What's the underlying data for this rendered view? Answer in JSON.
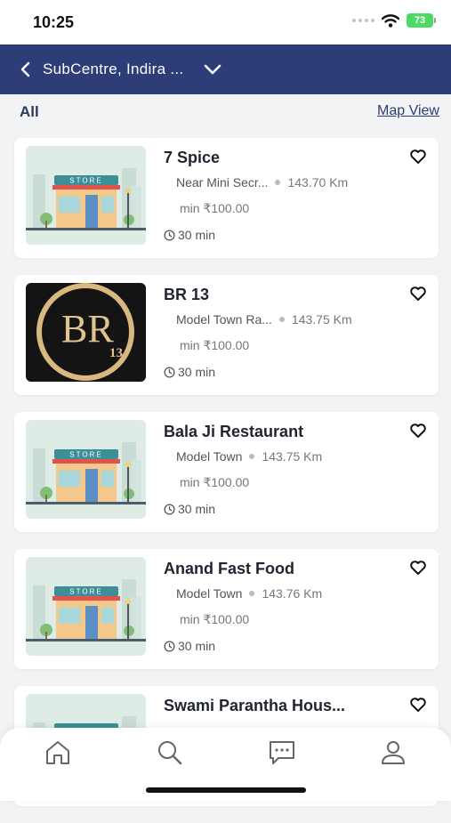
{
  "status_bar": {
    "time": "10:25",
    "battery": "73"
  },
  "header": {
    "location_title": "SubCentre, Indira ..."
  },
  "section": {
    "title": "All",
    "map_view_link": "Map View"
  },
  "restaurants": [
    {
      "name": "7 Spice",
      "location": "Near Mini Secr...",
      "distance": "143.70 Km",
      "min_order": "min ₹100.00",
      "delivery_time": "30 min",
      "image": "store-illustration"
    },
    {
      "name": "BR 13",
      "location": "Model Town Ra...",
      "distance": "143.75 Km",
      "min_order": "min ₹100.00",
      "delivery_time": "30 min",
      "image": "br13-logo",
      "logo_text": "BR",
      "logo_number": "13"
    },
    {
      "name": "Bala Ji Restaurant",
      "location": "Model Town",
      "distance": "143.75 Km",
      "min_order": "min ₹100.00",
      "delivery_time": "30 min",
      "image": "store-illustration"
    },
    {
      "name": "Anand Fast Food",
      "location": "Model Town",
      "distance": "143.76 Km",
      "min_order": "min ₹100.00",
      "delivery_time": "30 min",
      "image": "store-illustration"
    },
    {
      "name": "Swami Parantha Hous...",
      "image": "store-illustration"
    }
  ],
  "store_sign": "STORE",
  "tabbar": {
    "items": [
      "home-icon",
      "search-icon",
      "chat-icon",
      "profile-icon"
    ]
  },
  "colors": {
    "header_bg": "#2c3d78",
    "page_bg": "#f2f3f5",
    "battery": "#4cd964"
  }
}
